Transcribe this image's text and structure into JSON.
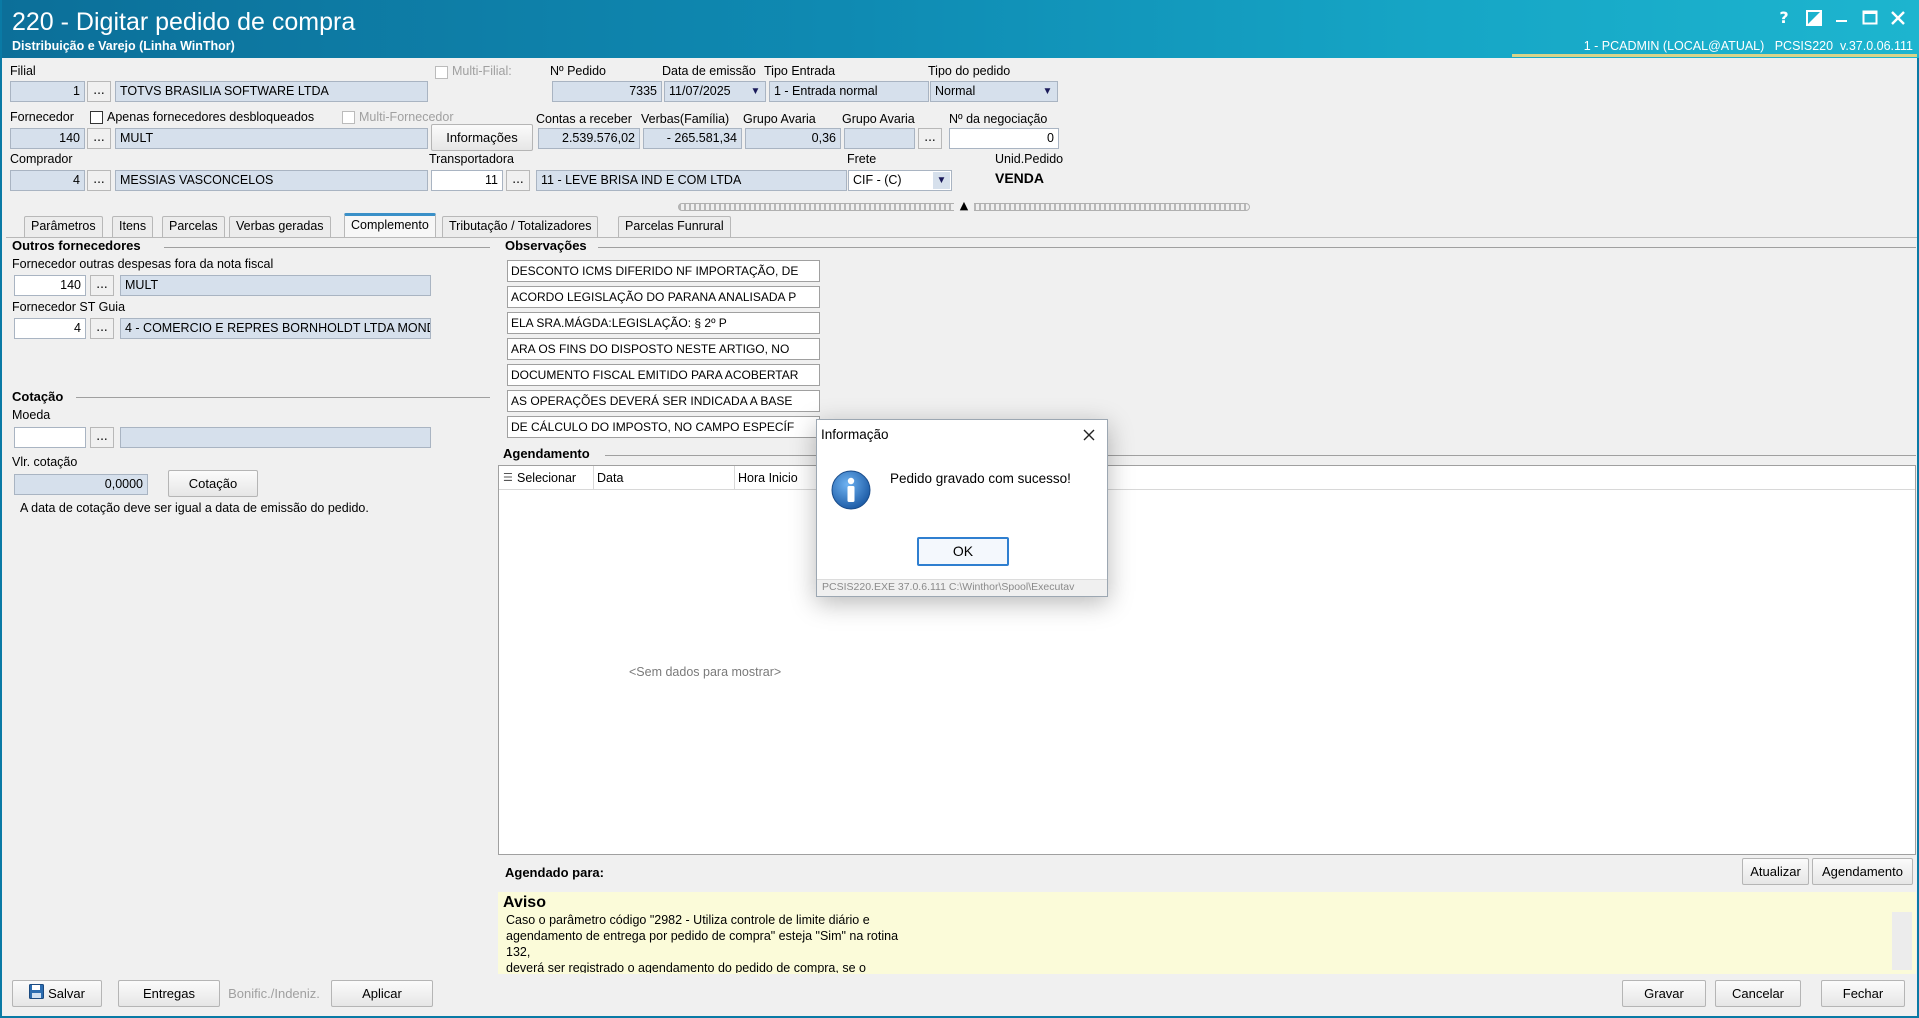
{
  "window": {
    "title": "220 - Digitar pedido de compra",
    "subtitle": "Distribuição e Varejo (Linha WinThor)",
    "status_right": "1 - PCADMIN (LOCAL@ATUAL)   PCSIS220  v.37.0.06.111",
    "help_icon": "?",
    "controls": [
      "help-icon",
      "theme-icon",
      "minimize-icon",
      "maximize-icon",
      "close-icon"
    ]
  },
  "header": {
    "filial_label": "Filial",
    "filial_code": "1",
    "filial_name": "TOTVS BRASILIA SOFTWARE LTDA",
    "multi_filial_label": "Multi-Filial:",
    "num_pedido_label": "Nº Pedido",
    "num_pedido": "7335",
    "data_emissao_label": "Data de emissão",
    "data_emissao": "11/07/2025",
    "tipo_entrada_label": "Tipo Entrada",
    "tipo_entrada": "1 - Entrada normal",
    "tipo_pedido_label": "Tipo do pedido",
    "tipo_pedido": "Normal",
    "fornecedor_label": "Fornecedor",
    "apenas_desbloq_label": "Apenas fornecedores desbloqueados",
    "multi_fornecedor_label": "Multi-Fornecedor",
    "fornecedor_code": "140",
    "fornecedor_name": "MULT",
    "informacoes_button": "Informações",
    "contas_receber_label": "Contas a receber",
    "contas_receber": "2.539.576,02",
    "verbas_label": "Verbas(Família)",
    "verbas": "- 265.581,34",
    "grupo_avaria_label": "Grupo Avaria",
    "grupo_avaria_value": "0,36",
    "grupo_avaria2_label": "Grupo Avaria",
    "negociacao_label": "Nº da negociação",
    "negociacao": "0",
    "comprador_label": "Comprador",
    "comprador_code": "4",
    "comprador_name": "MESSIAS VASCONCELOS",
    "transportadora_label": "Transportadora",
    "transportadora_code": "11",
    "transportadora_name": "11 - LEVE BRISA IND E COM LTDA",
    "frete_label": "Frete",
    "frete": "CIF - (C)",
    "unid_pedido_label": "Unid.Pedido",
    "unid_pedido": "VENDA",
    "dots": "..."
  },
  "tabs": [
    "Parâmetros",
    "Itens",
    "Parcelas",
    "Verbas geradas",
    "Complemento",
    "Tributação / Totalizadores",
    "Parcelas Funrural"
  ],
  "active_tab": "Complemento",
  "complemento": {
    "outros_title": "Outros fornecedores",
    "forn_despesas_label": "Fornecedor outras despesas fora da nota fiscal",
    "forn_despesas_code": "140",
    "forn_despesas_name": "MULT",
    "forn_st_label": "Fornecedor ST Guia",
    "forn_st_code": "4",
    "forn_st_name": "4 - COMERCIO E REPRES  BORNHOLDT LTDA MONDAI",
    "cotacao_title": "Cotação",
    "moeda_label": "Moeda",
    "moeda_code": "",
    "moeda_name": "",
    "vlr_cotacao_label": "Vlr. cotação",
    "vlr_cotacao": "0,0000",
    "cotacao_button": "Cotação",
    "cotacao_note": "A data de cotação deve ser igual a data de emissão do pedido.",
    "observacoes_title": "Observações",
    "observacoes": [
      "DESCONTO ICMS DIFERIDO NF IMPORTAÇÃO, DE",
      "ACORDO LEGISLAÇÃO DO PARANA ANALISADA P",
      "ELA SRA.MÁGDA:LEGISLAÇÃO: § 2º P",
      "ARA OS FINS DO DISPOSTO NESTE ARTIGO, NO",
      "DOCUMENTO FISCAL EMITIDO PARA ACOBERTAR",
      "AS OPERAÇÕES DEVERÁ SER INDICADA A BASE",
      "DE CÁLCULO DO IMPOSTO, NO CAMPO ESPECÍF"
    ],
    "agendamento_title": "Agendamento",
    "grid_columns": [
      "Selecionar",
      "Data",
      "Hora Inicio"
    ],
    "grid_empty": "<Sem dados para mostrar>",
    "agendado_para_label": "Agendado para:",
    "atualizar_button": "Atualizar",
    "agendamento_button": "Agendamento",
    "aviso_title": "Aviso",
    "aviso_lines": [
      "Caso o parâmetro código \"2982 - Utiliza controle de limite diário e",
      "agendamento de entrega por pedido de compra\" esteja \"Sim\" na rotina",
      "132,",
      "deverá ser registrado o agendamento do pedido de compra, se o"
    ]
  },
  "footer": {
    "salvar": "Salvar",
    "entregas": "Entregas",
    "bonific": "Bonific./Indeniz.",
    "aplicar": "Aplicar",
    "gravar": "Gravar",
    "cancelar": "Cancelar",
    "fechar": "Fechar"
  },
  "dialog": {
    "title": "Informação",
    "message": "Pedido gravado com sucesso!",
    "ok": "OK",
    "status": "PCSIS220.EXE 37.0.6.111 C:\\Winthor\\Spool\\Executav"
  },
  "colors": {
    "title_bar": "#0f8bb3",
    "field_bg": "#d6e0ec",
    "aviso_bg": "#fbfbd9",
    "tab_accent": "#3a90c8"
  }
}
